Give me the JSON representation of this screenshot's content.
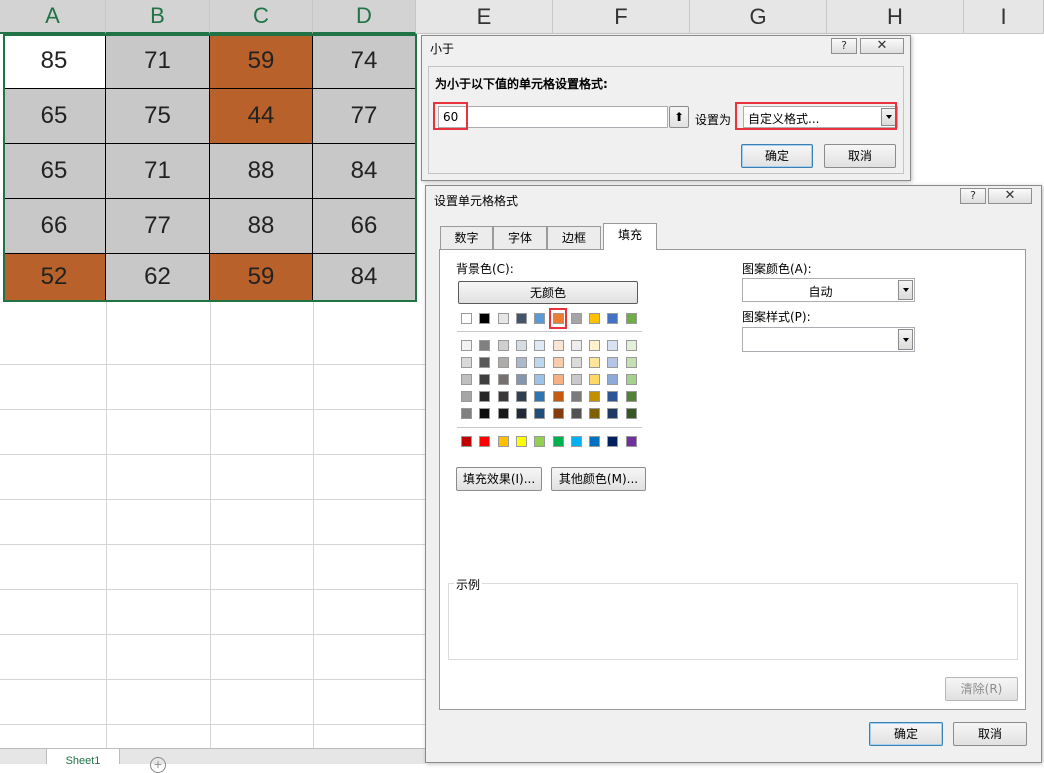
{
  "spreadsheet": {
    "columns": [
      "A",
      "B",
      "C",
      "D",
      "E",
      "F",
      "G",
      "H",
      "I"
    ],
    "selected_columns": [
      "A",
      "B",
      "C",
      "D"
    ],
    "rows": [
      [
        {
          "v": "85",
          "fill": "#ffffff"
        },
        {
          "v": "71",
          "fill": "#c8c8c8"
        },
        {
          "v": "59",
          "fill": "#b8612a"
        },
        {
          "v": "74",
          "fill": "#c8c8c8"
        }
      ],
      [
        {
          "v": "65",
          "fill": "#c8c8c8"
        },
        {
          "v": "75",
          "fill": "#c8c8c8"
        },
        {
          "v": "44",
          "fill": "#b8612a"
        },
        {
          "v": "77",
          "fill": "#c8c8c8"
        }
      ],
      [
        {
          "v": "65",
          "fill": "#c8c8c8"
        },
        {
          "v": "71",
          "fill": "#c8c8c8"
        },
        {
          "v": "88",
          "fill": "#c8c8c8"
        },
        {
          "v": "84",
          "fill": "#c8c8c8"
        }
      ],
      [
        {
          "v": "66",
          "fill": "#c8c8c8"
        },
        {
          "v": "77",
          "fill": "#c8c8c8"
        },
        {
          "v": "88",
          "fill": "#c8c8c8"
        },
        {
          "v": "66",
          "fill": "#c8c8c8"
        }
      ],
      [
        {
          "v": "52",
          "fill": "#b8612a"
        },
        {
          "v": "62",
          "fill": "#c8c8c8"
        },
        {
          "v": "59",
          "fill": "#b8612a"
        },
        {
          "v": "84",
          "fill": "#c8c8c8"
        }
      ]
    ],
    "sheet_tab": "Sheet1",
    "add_sheet_icon": "plus-circle-icon"
  },
  "less_than_dialog": {
    "title": "小于",
    "help_icon": "?",
    "close_icon": "close-icon",
    "prompt": "为小于以下值的单元格设置格式:",
    "value": "60",
    "collapse_icon": "collapse-arrow-icon",
    "set_as_label": "设置为",
    "format_value": "自定义格式...",
    "ok": "确定",
    "cancel": "取消"
  },
  "format_cells_dialog": {
    "title": "设置单元格格式",
    "help_icon": "?",
    "close_icon": "close-icon",
    "tabs": [
      "数字",
      "字体",
      "边框",
      "填充"
    ],
    "active_tab": "填充",
    "bg_color_label": "背景色(C):",
    "no_color": "无颜色",
    "theme_top_row": [
      "#ffffff",
      "#000000",
      "#e7e6e6",
      "#44546a",
      "#5b9bd5",
      "#ed7d31",
      "#a5a5a5",
      "#ffc000",
      "#4472c4",
      "#70ad47"
    ],
    "theme_shades": [
      [
        "#f2f2f2",
        "#808080",
        "#d0cece",
        "#d6dce4",
        "#deebf6",
        "#fbe5d5",
        "#ededed",
        "#fff2cc",
        "#d9e2f3",
        "#e2efd9"
      ],
      [
        "#d9d9d9",
        "#595959",
        "#aeabab",
        "#adb9ca",
        "#bdd7ee",
        "#f7cbac",
        "#dbdbdb",
        "#fee599",
        "#b4c6e7",
        "#c5e0b3"
      ],
      [
        "#bfbfbf",
        "#404040",
        "#757171",
        "#8496b0",
        "#9dc3e6",
        "#f4b183",
        "#c9c9c9",
        "#ffd965",
        "#8eaadb",
        "#a8d08d"
      ],
      [
        "#a6a6a6",
        "#262626",
        "#3a3838",
        "#323f4f",
        "#2e75b5",
        "#c55a11",
        "#7b7b7b",
        "#bf9000",
        "#2f5496",
        "#538135"
      ],
      [
        "#808080",
        "#0d0d0d",
        "#171616",
        "#222a35",
        "#1e4e79",
        "#843c0b",
        "#525252",
        "#7f6000",
        "#1f3864",
        "#375623"
      ]
    ],
    "standard_colors": [
      "#c00000",
      "#ff0000",
      "#ffc000",
      "#ffff00",
      "#92d050",
      "#00b050",
      "#00b0f0",
      "#0070c0",
      "#002060",
      "#7030a0"
    ],
    "selected_swatch_index": 5,
    "fill_effects": "填充效果(I)...",
    "more_colors": "其他颜色(M)...",
    "pattern_color_label": "图案颜色(A):",
    "pattern_color_value": "自动",
    "pattern_style_label": "图案样式(P):",
    "pattern_style_value": "",
    "sample_label": "示例",
    "clear": "清除(R)",
    "ok": "确定",
    "cancel": "取消"
  }
}
